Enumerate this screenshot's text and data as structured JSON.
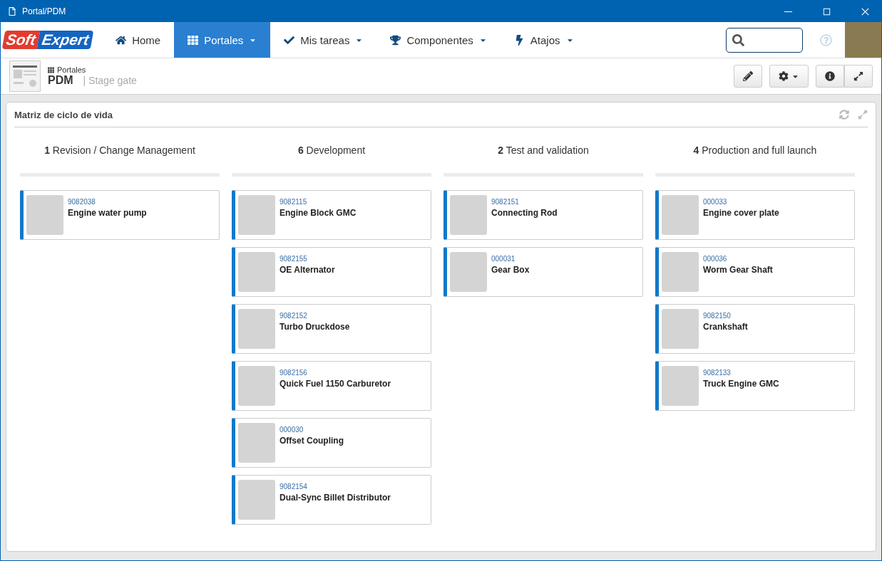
{
  "window": {
    "title": "Portal/PDM"
  },
  "logo": {
    "part1": "Soft",
    "part2": "Expert"
  },
  "nav": [
    {
      "label": "Home",
      "kind": "home",
      "dropdown": false,
      "selected": false
    },
    {
      "label": "Portales",
      "kind": "grid",
      "dropdown": true,
      "selected": true
    },
    {
      "label": "Mis tareas",
      "kind": "check",
      "dropdown": true,
      "selected": false
    },
    {
      "label": "Componentes",
      "kind": "trophy",
      "dropdown": true,
      "selected": false
    },
    {
      "label": "Atajos",
      "kind": "bolt",
      "dropdown": true,
      "selected": false
    }
  ],
  "breadcrumb": {
    "parent": "Portales",
    "title": "PDM",
    "subtitle": "| Stage gate"
  },
  "panel": {
    "title": "Matriz de ciclo de vida"
  },
  "columns": [
    {
      "count": "1",
      "title": "Revision / Change Management",
      "cards": [
        {
          "code": "9082038",
          "name": "Engine water pump"
        }
      ]
    },
    {
      "count": "6",
      "title": "Development",
      "cards": [
        {
          "code": "9082115",
          "name": "Engine Block GMC"
        },
        {
          "code": "9082155",
          "name": "OE Alternator"
        },
        {
          "code": "9082152",
          "name": "Turbo Druckdose"
        },
        {
          "code": "9082156",
          "name": "Quick Fuel 1150 Carburetor"
        },
        {
          "code": "000030",
          "name": "Offset Coupling"
        },
        {
          "code": "9082154",
          "name": "Dual-Sync Billet Distributor"
        }
      ]
    },
    {
      "count": "2",
      "title": "Test and validation",
      "cards": [
        {
          "code": "9082151",
          "name": "Connecting Rod"
        },
        {
          "code": "000031",
          "name": "Gear Box"
        }
      ]
    },
    {
      "count": "4",
      "title": "Production and full launch",
      "cards": [
        {
          "code": "000033",
          "name": "Engine cover plate"
        },
        {
          "code": "000036",
          "name": "Worm Gear Shaft"
        },
        {
          "code": "9082150",
          "name": "Crankshaft"
        },
        {
          "code": "9082133",
          "name": "Truck Engine GMC"
        }
      ]
    }
  ]
}
